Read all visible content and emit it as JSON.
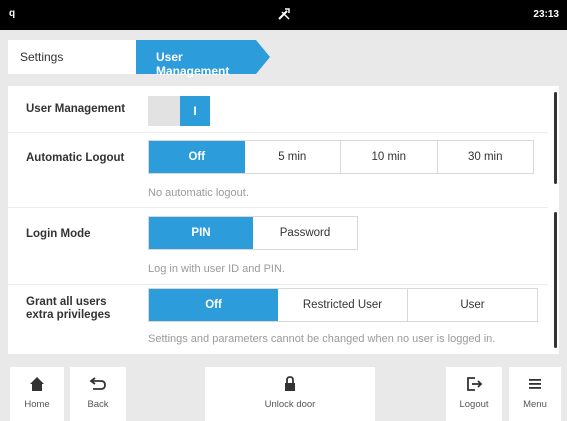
{
  "statusbar": {
    "left": "q",
    "time": "23:13"
  },
  "breadcrumb": {
    "crumb1": "Settings",
    "crumb2": "User Management"
  },
  "rows": {
    "user_management": {
      "label": "User Management",
      "toggle_state": "I"
    },
    "auto_logout": {
      "label": "Automatic Logout",
      "options": [
        "Off",
        "5 min",
        "10 min",
        "30 min"
      ],
      "selected": "Off",
      "hint": "No automatic logout."
    },
    "login_mode": {
      "label": "Login Mode",
      "options": [
        "PIN",
        "Password"
      ],
      "selected": "PIN",
      "hint": "Log in with user ID and PIN."
    },
    "grant": {
      "label_line1": "Grant all users",
      "label_line2": "extra privileges",
      "options": [
        "Off",
        "Restricted User",
        "User"
      ],
      "selected": "Off",
      "hint": "Settings and parameters cannot be changed when no user is logged in."
    }
  },
  "bottombar": {
    "home": "Home",
    "back": "Back",
    "unlock": "Unlock door",
    "logout": "Logout",
    "menu": "Menu"
  },
  "colors": {
    "accent": "#2d9cdb",
    "background": "#e9e9e9"
  },
  "icons": [
    "status-left-icon",
    "tools-icon",
    "home-icon",
    "back-icon",
    "lock-icon",
    "logout-icon",
    "menu-icon"
  ]
}
